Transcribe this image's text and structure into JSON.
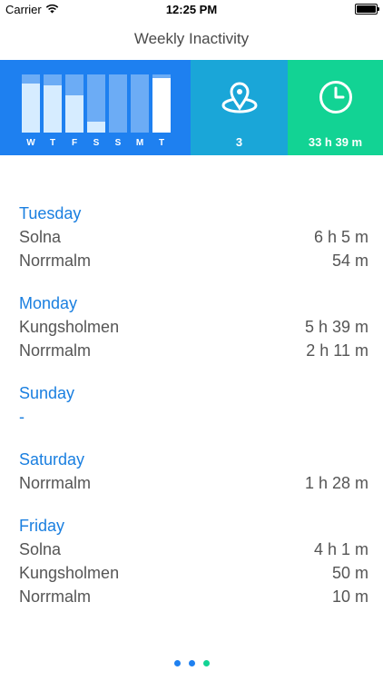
{
  "status": {
    "carrier": "Carrier",
    "time": "12:25 PM"
  },
  "nav": {
    "title": "Weekly Inactivity"
  },
  "summary": {
    "chart": {
      "days": [
        "W",
        "T",
        "F",
        "S",
        "S",
        "M",
        "T"
      ],
      "fill_fractions": [
        0.85,
        0.82,
        0.64,
        0.18,
        0.0,
        0.0,
        0.93
      ]
    },
    "locations": {
      "value": "3",
      "icon": "map-pin-icon"
    },
    "time": {
      "value": "33 h 39 m",
      "icon": "clock-icon"
    },
    "colors": {
      "chart": "#1e80f0",
      "locations": "#1aa6d8",
      "time": "#12d394",
      "accent": "#1a7fe0"
    }
  },
  "days": [
    {
      "title": "Tuesday",
      "rows": [
        {
          "place": "Solna",
          "duration": "6 h 5 m"
        },
        {
          "place": "Norrmalm",
          "duration": "54 m"
        }
      ]
    },
    {
      "title": "Monday",
      "rows": [
        {
          "place": "Kungsholmen",
          "duration": "5 h 39 m"
        },
        {
          "place": "Norrmalm",
          "duration": "2 h 11 m"
        }
      ]
    },
    {
      "title": "Sunday",
      "empty": "-"
    },
    {
      "title": "Saturday",
      "rows": [
        {
          "place": "Norrmalm",
          "duration": "1 h 28 m"
        }
      ]
    },
    {
      "title": "Friday",
      "rows": [
        {
          "place": "Solna",
          "duration": "4 h 1 m"
        },
        {
          "place": "Kungsholmen",
          "duration": "50 m"
        },
        {
          "place": "Norrmalm",
          "duration": "10 m"
        }
      ]
    }
  ],
  "pager": {
    "count": 3,
    "active": 2,
    "colors": [
      "#1e80f0",
      "#1e80f0",
      "#12d394"
    ]
  }
}
